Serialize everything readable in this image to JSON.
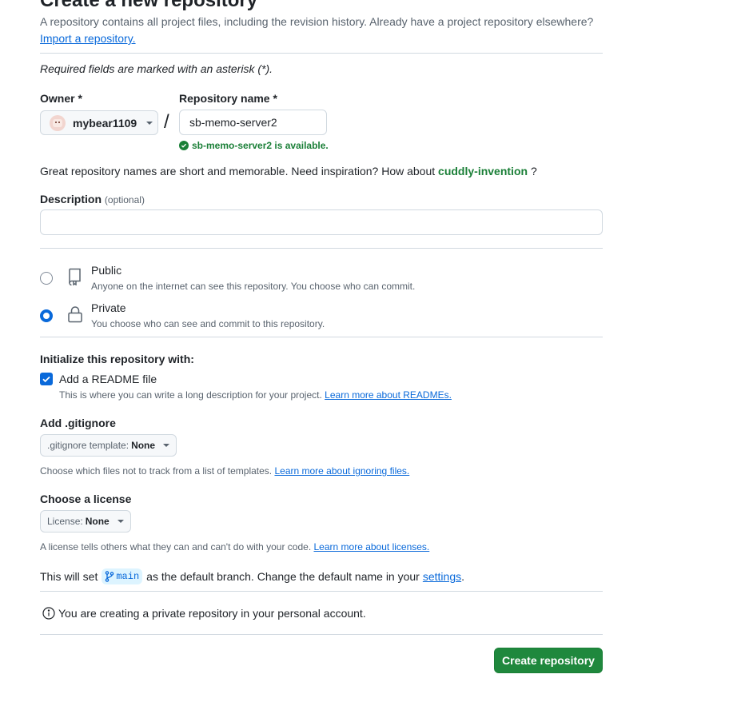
{
  "header": {
    "title": "Create a new repository",
    "subtitle": "A repository contains all project files, including the revision history. Already have a project repository elsewhere?",
    "import_link": "Import a repository."
  },
  "required_note": "Required fields are marked with an asterisk (*).",
  "owner": {
    "label": "Owner *",
    "value": "mybear1109"
  },
  "separator": "/",
  "repo_name": {
    "label": "Repository name *",
    "value": "sb-memo-server2",
    "availability": "sb-memo-server2 is available."
  },
  "inspiration": {
    "text": "Great repository names are short and memorable. Need inspiration? How about",
    "suggestion": "cuddly-invention",
    "suffix": "?"
  },
  "description": {
    "label": "Description",
    "optional": "(optional)",
    "value": ""
  },
  "visibility": {
    "options": [
      {
        "title": "Public",
        "desc": "Anyone on the internet can see this repository. You choose who can commit.",
        "selected": false,
        "icon": "repo-icon"
      },
      {
        "title": "Private",
        "desc": "You choose who can see and commit to this repository.",
        "selected": true,
        "icon": "lock-icon"
      }
    ]
  },
  "initialize": {
    "heading": "Initialize this repository with:",
    "readme_label": "Add a README file",
    "readme_checked": true,
    "readme_desc": "This is where you can write a long description for your project.",
    "readme_link": "Learn more about READMEs."
  },
  "gitignore": {
    "heading": "Add .gitignore",
    "select_prefix": ".gitignore template:",
    "select_value": "None",
    "desc": "Choose which files not to track from a list of templates.",
    "link": "Learn more about ignoring files."
  },
  "license": {
    "heading": "Choose a license",
    "select_prefix": "License:",
    "select_value": "None",
    "desc": "A license tells others what they can and can't do with your code.",
    "link": "Learn more about licenses."
  },
  "branch": {
    "prefix": "This will set",
    "name": "main",
    "middle": "as the default branch. Change the default name in your",
    "link": "settings",
    "suffix": "."
  },
  "info": "You are creating a private repository in your personal account.",
  "submit": "Create repository",
  "colors": {
    "accent": "#0969da",
    "success": "#1a7f37",
    "primary_button": "#1f883d"
  }
}
